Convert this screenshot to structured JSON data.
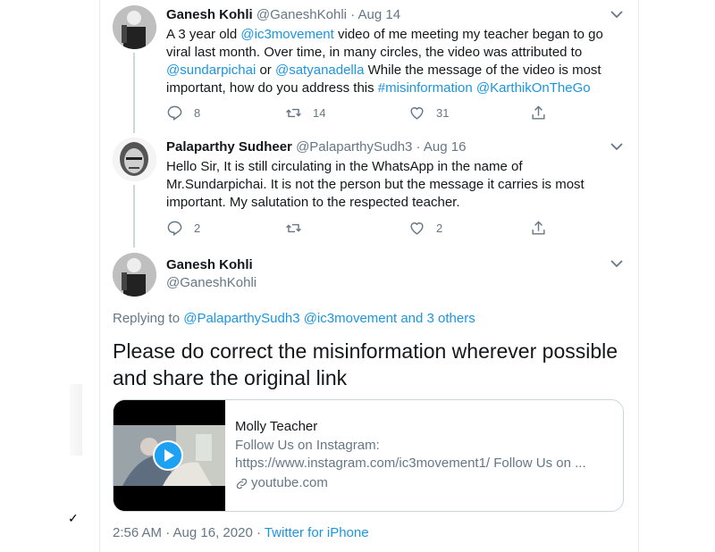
{
  "tweets": [
    {
      "name": "Ganesh Kohli",
      "handle": "@GaneshKohli",
      "sep": "·",
      "date": "Aug 14",
      "text": [
        {
          "t": "A 3 year old ",
          "link": false
        },
        {
          "t": "@ic3movement",
          "link": true
        },
        {
          "t": " video of me meeting my teacher began to go viral last month. Over time, in many circles, the video was attributed to ",
          "link": false
        },
        {
          "t": "@sundarpichai",
          "link": true
        },
        {
          "t": " or ",
          "link": false
        },
        {
          "t": "@satyanadella",
          "link": true
        },
        {
          "t": " While the message of the video is most important, how do you address this ",
          "link": false
        },
        {
          "t": "#misinformation",
          "link": true
        },
        {
          "t": " ",
          "link": false
        },
        {
          "t": "@KarthikOnTheGo",
          "link": true
        }
      ],
      "reply_count": "8",
      "retweet_count": "14",
      "like_count": "31"
    },
    {
      "name": "Palaparthy Sudheer",
      "handle": "@PalaparthySudh3",
      "sep": "·",
      "date": "Aug 16",
      "text": [
        {
          "t": "Hello Sir, It is still circulating in the WhatsApp in the name of Mr.Sundarpichai.  It is not the person but the message it carries is most important.  My salutation to the respected teacher.",
          "link": false
        }
      ],
      "reply_count": "2",
      "retweet_count": "",
      "like_count": "2"
    }
  ],
  "main_tweet": {
    "name": "Ganesh Kohli",
    "handle": "@GaneshKohli",
    "replying_prefix": "Replying to ",
    "replying_links": [
      "@PalaparthySudh3",
      "@ic3movement",
      "and 3 others"
    ],
    "text": "Please do correct the misinformation wherever possible and share the original link",
    "card": {
      "title": "Molly Teacher",
      "desc_line1": "Follow Us on Instagram:",
      "desc_line2": "https://www.instagram.com/ic3movement1/ Follow Us on ...",
      "domain": "youtube.com"
    },
    "timestamp": "2:56 AM · Aug 16, 2020 · ",
    "source": "Twitter for iPhone"
  },
  "icons": {
    "reply": "reply-icon",
    "retweet": "retweet-icon",
    "like": "heart-icon",
    "share": "share-icon",
    "caret": "chevron-down-icon",
    "link": "link-icon",
    "play": "play-icon"
  },
  "colors": {
    "link": "#1b95e0",
    "text": "#14171a",
    "secondary": "#657786",
    "border": "#e6ecf0"
  },
  "checkmark": "✓"
}
